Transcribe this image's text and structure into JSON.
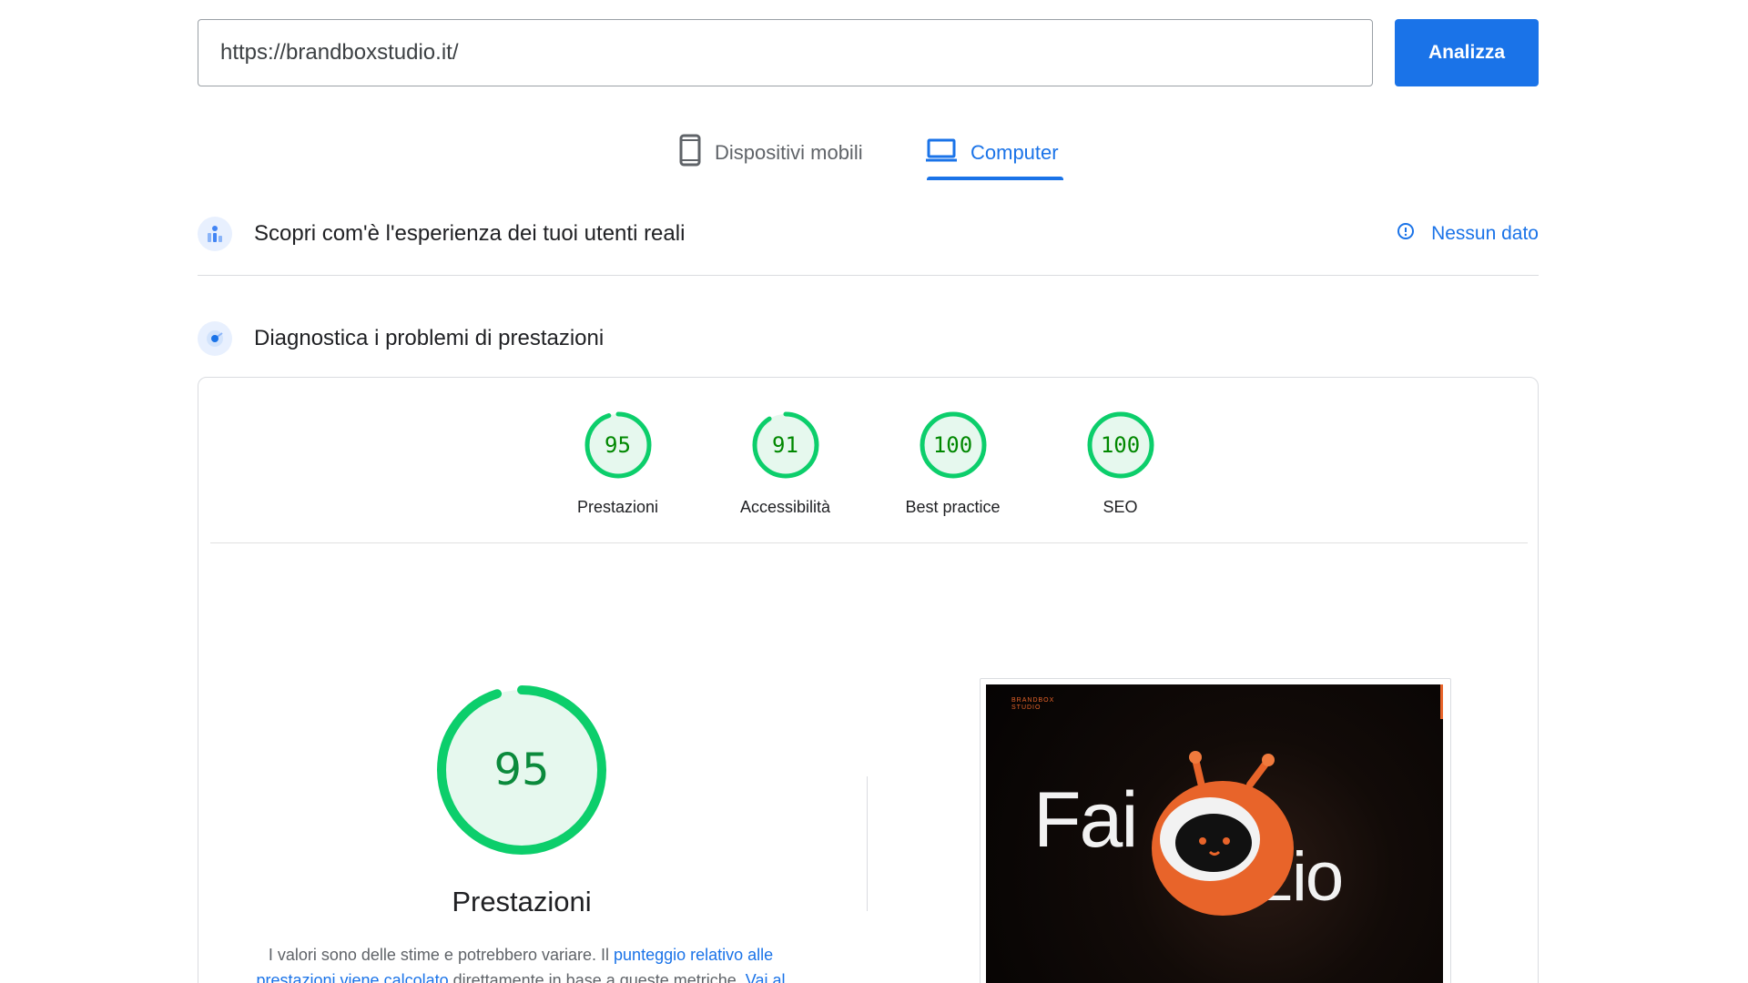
{
  "search": {
    "url_value": "https://brandboxstudio.it/",
    "analyze_label": "Analizza"
  },
  "tabs": [
    {
      "label": "Dispositivi mobili",
      "icon": "smartphone-icon",
      "selected": false
    },
    {
      "label": "Computer",
      "icon": "laptop-icon",
      "selected": true
    }
  ],
  "crux": {
    "title": "Scopri com'è l'esperienza dei tuoi utenti reali",
    "icon": "users-chart-icon",
    "status_label": "Nessun dato",
    "status_icon": "info-icon"
  },
  "diagnostics": {
    "title": "Diagnostica i problemi di prestazioni",
    "icon": "lighthouse-icon"
  },
  "scores": [
    {
      "label": "Prestazioni",
      "value": "95",
      "fraction": 0.95
    },
    {
      "label": "Accessibilità",
      "value": "91",
      "fraction": 0.91
    },
    {
      "label": "Best practice",
      "value": "100",
      "fraction": 1.0
    },
    {
      "label": "SEO",
      "value": "100",
      "fraction": 1.0
    }
  ],
  "performance": {
    "value": "95",
    "fraction": 0.95,
    "title": "Prestazioni",
    "desc_text_1": "I valori sono delle stime e potrebbero variare. Il ",
    "desc_link_1": "punteggio relativo alle prestazioni viene calcolato",
    "desc_text_2": " direttamente in base a queste metriche. ",
    "desc_link_2": "Vai al"
  },
  "preview": {
    "brand_line_1": "BRANDBOX",
    "brand_line_2": "STUDIO",
    "headline_part_1": "Fai",
    "headline_part_2": "zio"
  },
  "colors": {
    "accent": "#1a73e8",
    "pass_green": "#0cce6b",
    "pass_fill": "#e6f8ee",
    "brand_orange": "#e8642a"
  }
}
